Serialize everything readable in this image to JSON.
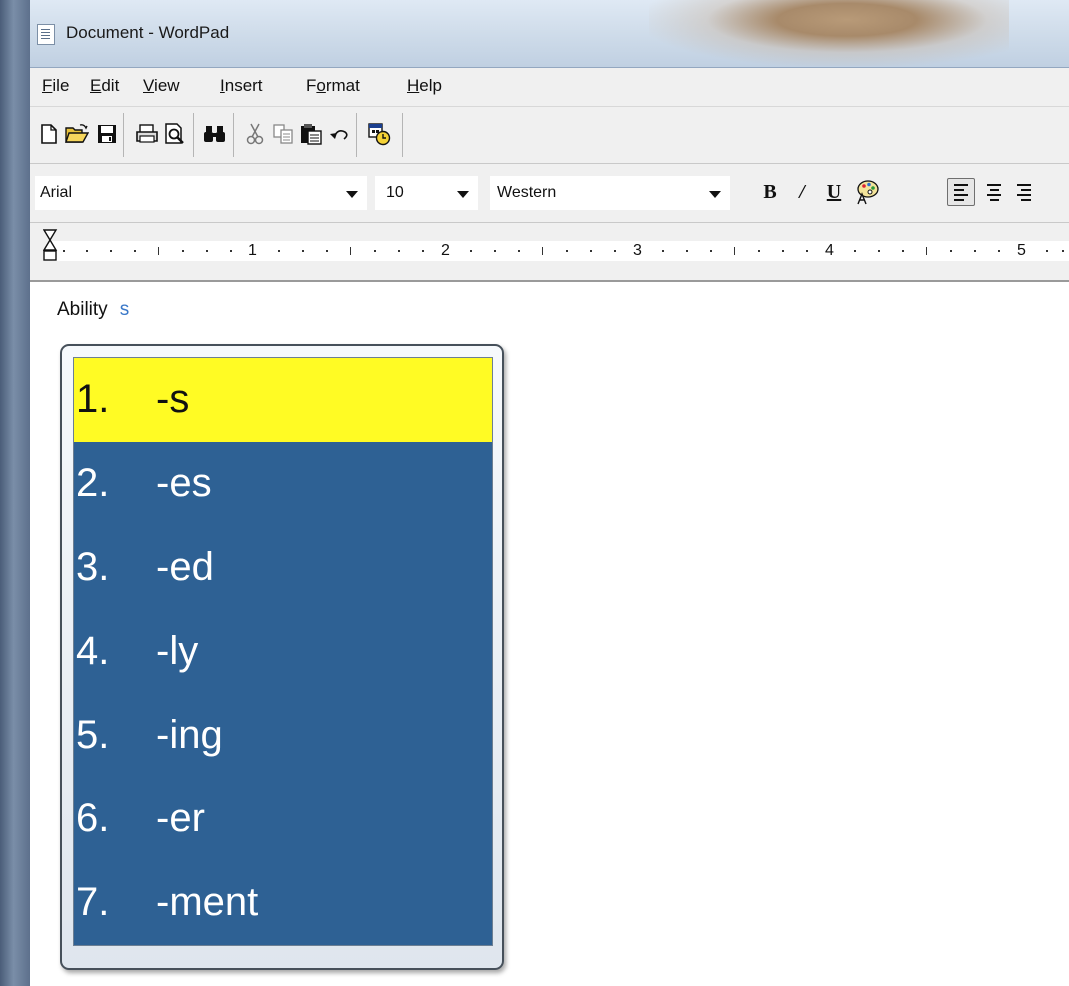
{
  "window": {
    "title": "Document - WordPad"
  },
  "menu": {
    "items": [
      {
        "label": "File",
        "mnemonic": "F",
        "rest": "ile"
      },
      {
        "label": "Edit",
        "mnemonic": "E",
        "rest": "dit"
      },
      {
        "label": "View",
        "mnemonic": "V",
        "rest": "iew"
      },
      {
        "label": "Insert",
        "mnemonic": "I",
        "rest": "nsert"
      },
      {
        "label": "Format",
        "pre": "F",
        "mnemonic": "o",
        "rest": "rmat"
      },
      {
        "label": "Help",
        "mnemonic": "H",
        "rest": "elp"
      }
    ]
  },
  "toolbar": {
    "buttons": [
      "new-icon",
      "open-icon",
      "save-icon",
      "print-icon",
      "print-preview-icon",
      "find-icon",
      "cut-icon",
      "copy-icon",
      "paste-icon",
      "undo-icon",
      "insert-datetime-icon"
    ]
  },
  "format": {
    "font": "Arial",
    "size": "10",
    "script": "Western",
    "bold_label": "B",
    "italic_label": "/",
    "underline_label": "U"
  },
  "ruler": {
    "numbers": [
      "1",
      "2",
      "3",
      "4",
      "5"
    ]
  },
  "document": {
    "text": "Ability",
    "typed": "s"
  },
  "prediction": {
    "items": [
      {
        "num": "1.",
        "word": "-s",
        "selected": true
      },
      {
        "num": "2.",
        "word": "-es",
        "selected": false
      },
      {
        "num": "3.",
        "word": "-ed",
        "selected": false
      },
      {
        "num": "4.",
        "word": "-ly",
        "selected": false
      },
      {
        "num": "5.",
        "word": "-ing",
        "selected": false
      },
      {
        "num": "6.",
        "word": "-er",
        "selected": false
      },
      {
        "num": "7.",
        "word": "-ment",
        "selected": false
      }
    ],
    "colors": {
      "list_bg": "#2e6194",
      "selected_bg": "#fffb24"
    }
  }
}
